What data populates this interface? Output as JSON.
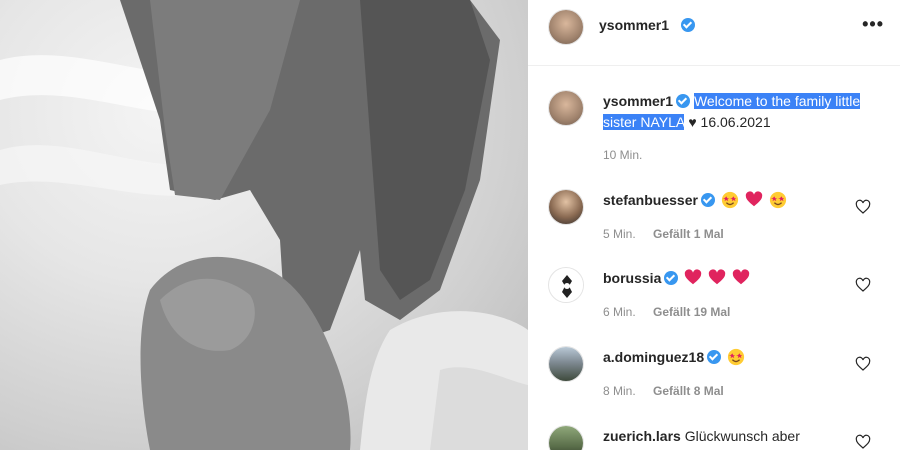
{
  "post": {
    "author": "ysommer1",
    "caption_highlight": "Welcome to the family little sister NAYLA",
    "caption_rest": "♥ 16.06.2021",
    "time": "10 Min."
  },
  "header": {
    "username": "ysommer1",
    "more_label": "•••"
  },
  "comments": [
    {
      "username": "stefanbuesser",
      "time": "5 Min.",
      "likes": "Gefällt 1 Mal"
    },
    {
      "username": "borussia",
      "time": "6 Min.",
      "likes": "Gefällt 19 Mal"
    },
    {
      "username": "a.dominguez18",
      "time": "8 Min.",
      "likes": "Gefällt 8 Mal"
    },
    {
      "username": "zuerich.lars",
      "text": "Glückwunsch aber"
    }
  ],
  "colors": {
    "verified": "#3897f0",
    "highlight": "#3b82f6",
    "heart": "#e0245e"
  }
}
